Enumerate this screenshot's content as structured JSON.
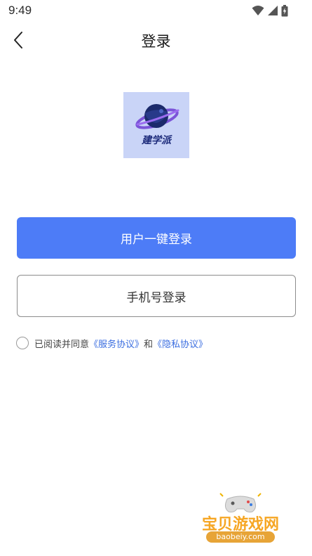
{
  "status_bar": {
    "time": "9:49",
    "icons": [
      "wifi-icon",
      "signal-icon",
      "battery-icon"
    ]
  },
  "header": {
    "back_icon": "chevron-left-icon",
    "title": "登录"
  },
  "logo": {
    "text": "建学派",
    "background_color": "#c9d4f7"
  },
  "buttons": {
    "one_click_login": "用户一键登录",
    "phone_login": "手机号登录",
    "primary_color": "#4d7cf7"
  },
  "agreement": {
    "prefix": "已阅读并同意",
    "service_link": "《服务协议》",
    "conjunction": "和",
    "privacy_link": "《隐私协议》",
    "link_color": "#3b6ee0"
  },
  "watermark": {
    "title": "宝贝游戏网",
    "url": "baobeiy.com"
  }
}
